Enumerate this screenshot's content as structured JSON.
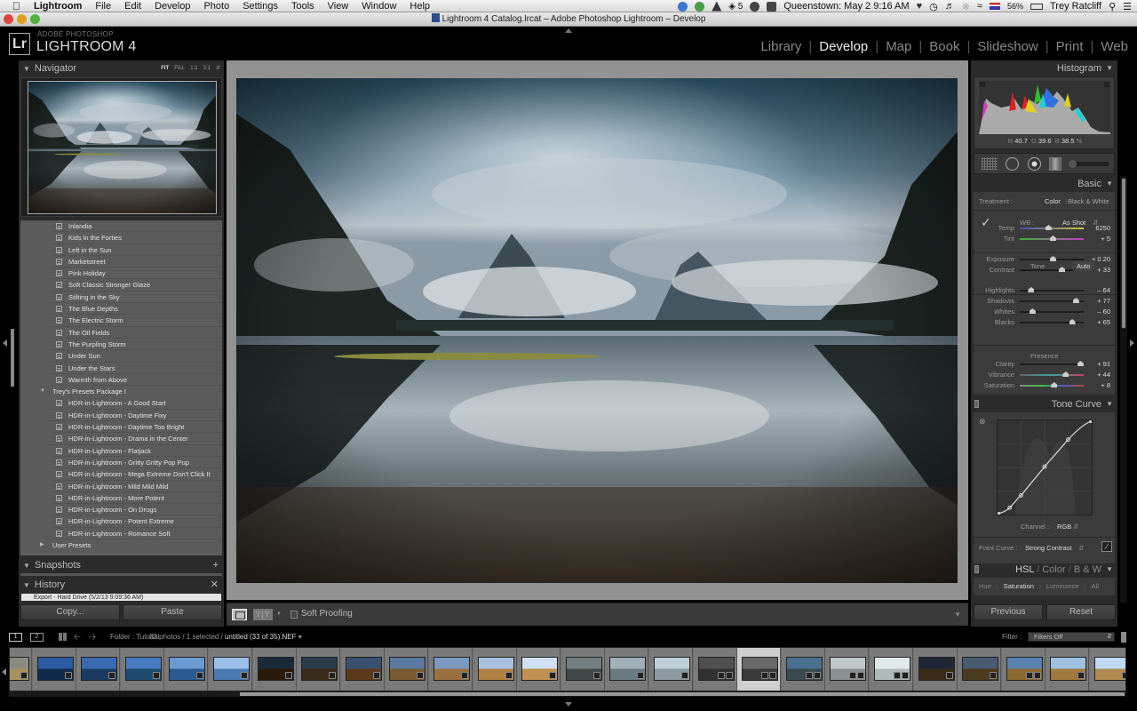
{
  "menubar": {
    "app": "Lightroom",
    "items": [
      "File",
      "Edit",
      "Develop",
      "Photo",
      "Settings",
      "Tools",
      "View",
      "Window",
      "Help"
    ],
    "status": {
      "badge_count": "5",
      "clock": "Queenstown: May 2  9:16 AM",
      "battery": "56%",
      "user": "Trey Ratcliff"
    }
  },
  "window": {
    "title": "Lightroom 4 Catalog.lrcat – Adobe Photoshop Lightroom – Develop"
  },
  "branding": {
    "logo": "Lr",
    "subtitle": "ADOBE PHOTOSHOP",
    "product": "LIGHTROOM 4"
  },
  "modules": [
    {
      "label": "Library",
      "active": false
    },
    {
      "label": "Develop",
      "active": true
    },
    {
      "label": "Map",
      "active": false
    },
    {
      "label": "Book",
      "active": false
    },
    {
      "label": "Slideshow",
      "active": false
    },
    {
      "label": "Print",
      "active": false
    },
    {
      "label": "Web",
      "active": false
    }
  ],
  "left_panel": {
    "navigator": {
      "title": "Navigator",
      "zoom_options": [
        "FIT",
        "FILL",
        "1:1",
        "3:1"
      ],
      "zoom_active": "FIT"
    },
    "presets_above": [
      "Inlandia",
      "Kids in the Forties",
      "Left in the Sun",
      "Marketstreet",
      "Pink Holiday",
      "Soft Classic Stronger Glaze",
      "Stilting in the Sky",
      "The Blue Depths",
      "The Electric Storm",
      "The Oil Fields",
      "The Purpling Storm",
      "Under Sun",
      "Under the Stars",
      "Warmth from Above"
    ],
    "folder_open": "Trey's Presets Package I",
    "presets_package": [
      "HDR-in-Lightroom - A Good Start",
      "HDR-in-Lightroom - Daytime Fixy",
      "HDR-in-Lightroom - Daytime Too Bright",
      "HDR-in-Lightroom - Drama in the Center",
      "HDR-in-Lightroom - Flatjack",
      "HDR-in-Lightroom - Gritty Gritty Pop Pop",
      "HDR-in-Lightroom - Mega Extreme Don't Click It",
      "HDR-in-Lightroom - Mild Mild Mild",
      "HDR-in-Lightroom - More Potent",
      "HDR-in-Lightroom - On Drugs",
      "HDR-in-Lightroom - Potent Extreme",
      "HDR-in-Lightroom - Romance Soft"
    ],
    "folder_closed": "User Presets",
    "snapshots": {
      "title": "Snapshots",
      "add": "+"
    },
    "history": {
      "title": "History",
      "clear": "✕",
      "item": "Export - Hard Drive (5/2/13 9:09:36 AM)"
    },
    "copy_label": "Copy...",
    "paste_label": "Paste"
  },
  "toolbar": {
    "yy_label": "Y|Y",
    "soft_proofing": "Soft Proofing",
    "soft_proofing_checked": false
  },
  "right_panel": {
    "histogram": {
      "title": "Histogram",
      "r_label": "R",
      "r": "40.7",
      "g_label": "G",
      "g": "39.6",
      "b_label": "B",
      "b": "38.5",
      "unit": "%"
    },
    "basic": {
      "title": "Basic",
      "treatment_label": "Treatment :",
      "treatment_color": "Color",
      "treatment_bw": "Black & White",
      "wb_label": "WB :",
      "wb_value": "As Shot",
      "tone_label": "Tone",
      "auto_label": "Auto",
      "presence_label": "Presence",
      "sliders": [
        {
          "name": "Temp",
          "value": "6250",
          "pos": 0.45
        },
        {
          "name": "Tint",
          "value": "+ 5",
          "pos": 0.52
        },
        {
          "name": "Exposure",
          "value": "+ 0.20",
          "pos": 0.52
        },
        {
          "name": "Contrast",
          "value": "+ 33",
          "pos": 0.66
        },
        {
          "name": "Highlights",
          "value": "– 64",
          "pos": 0.18
        },
        {
          "name": "Shadows",
          "value": "+ 77",
          "pos": 0.88
        },
        {
          "name": "Whites",
          "value": "– 60",
          "pos": 0.2
        },
        {
          "name": "Blacks",
          "value": "+ 65",
          "pos": 0.82
        },
        {
          "name": "Clarity",
          "value": "+ 91",
          "pos": 0.95
        },
        {
          "name": "Vibrance",
          "value": "+ 44",
          "pos": 0.72
        },
        {
          "name": "Saturation",
          "value": "+ 8",
          "pos": 0.54
        }
      ]
    },
    "tone_curve": {
      "title": "Tone Curve",
      "channel_label": "Channel :",
      "channel_value": "RGB",
      "point_curve_label": "Point Curve :",
      "point_curve_value": "Strong Contrast"
    },
    "hsl": {
      "title_parts": [
        "HSL",
        "Color",
        "B & W"
      ],
      "tabs": [
        "Hue",
        "Saturation",
        "Luminance",
        "All"
      ],
      "active_tab": "Saturation"
    },
    "previous_label": "Previous",
    "reset_label": "Reset"
  },
  "filmstrip_bar": {
    "monitor1": "1",
    "monitor2": "2",
    "folder": "Folder : Tutorial",
    "count": "32 photos / 1 selected /",
    "filename": "untitled (33 of 35).NEF",
    "filter_label": "Filter :",
    "filter_value": "Filters Off"
  },
  "filmstrip": {
    "selected_index": 17,
    "thumbs": [
      {
        "c1": "#8a8a80",
        "c2": "#a89060"
      },
      {
        "c1": "#2b5aa0",
        "c2": "#0f2a4a"
      },
      {
        "c1": "#3a6ab0",
        "c2": "#1a3a60"
      },
      {
        "c1": "#4a7ac0",
        "c2": "#1f4a70"
      },
      {
        "c1": "#6a9ad0",
        "c2": "#2a5a90"
      },
      {
        "c1": "#9ac0e8",
        "c2": "#4a7ab0"
      },
      {
        "c1": "#1a2a3a",
        "c2": "#2a1a0a"
      },
      {
        "c1": "#2a3a4a",
        "c2": "#3a2a1a"
      },
      {
        "c1": "#3a5070",
        "c2": "#5a3a1a"
      },
      {
        "c1": "#5a7aa0",
        "c2": "#7a5a30"
      },
      {
        "c1": "#7a9ac0",
        "c2": "#9a7040"
      },
      {
        "c1": "#aac0e0",
        "c2": "#b08040"
      },
      {
        "c1": "#d0e0f0",
        "c2": "#c09050"
      },
      {
        "c1": "#708080",
        "c2": "#404848"
      },
      {
        "c1": "#a0b0b8",
        "c2": "#6a7a80"
      },
      {
        "c1": "#c0d0d8",
        "c2": "#8a9aa0"
      },
      {
        "c1": "#505050",
        "c2": "#303030"
      },
      {
        "c1": "#6a6a6a",
        "c2": "#3a3a3a"
      },
      {
        "c1": "#4a7090",
        "c2": "#3a4850"
      },
      {
        "c1": "#c0c8c8",
        "c2": "#8a9090"
      },
      {
        "c1": "#e0e8e8",
        "c2": "#b0b8b8"
      },
      {
        "c1": "#202838",
        "c2": "#3a2a18"
      },
      {
        "c1": "#4a5a70",
        "c2": "#4a3a20"
      },
      {
        "c1": "#5a80b0",
        "c2": "#8a6a30"
      },
      {
        "c1": "#a0c0e0",
        "c2": "#a07a40"
      },
      {
        "c1": "#c0d8f0",
        "c2": "#b08a50"
      }
    ]
  }
}
